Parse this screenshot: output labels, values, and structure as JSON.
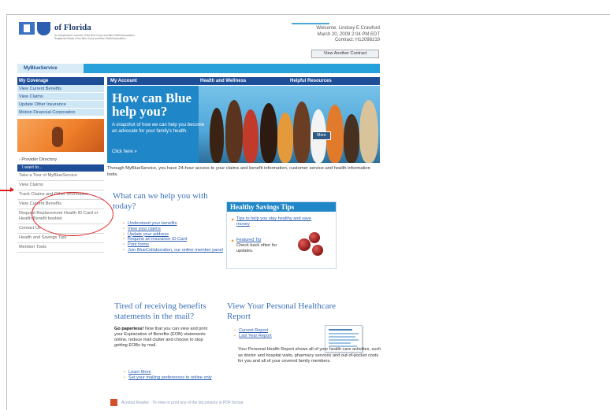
{
  "header": {
    "brand": "of Florida",
    "brand_sub": "An Independent Licensee of the Blue Cross and Blue Shield Association. Registered Marks of the Blue Cross and Blue Shield Association",
    "welcome_line": "Welcome, Lindsey E Crawford",
    "datetime": "March 20, 2009 2:04 PM EDT",
    "contract": "Contract: H12098219",
    "view_contract_button": "View Another Contract"
  },
  "brand_tab": "MyBlueService",
  "nav": {
    "my_coverage": "My Coverage",
    "my_account": "My Account",
    "health_wellness": "Health and Wellness",
    "helpful_resources": "Helpful Resources"
  },
  "coverage_items": [
    "View Current Benefits",
    "View Claims",
    "Update Other Insurance",
    "Motion Financial Corporation"
  ],
  "provider_link": "Provider Directory",
  "left_panel": {
    "head": "I want to...",
    "items": [
      "Take a Tour of MyBlueService",
      "View Claims",
      "Track Claims and Other Information",
      "View Current Benefits",
      "Request Replacement Health ID Card or Health Benefit booklet",
      "Contact Us",
      "Health and Savings Tips",
      "Member Tools"
    ]
  },
  "hero": {
    "title": "How can Blue help you?",
    "text": "A snapshot of how we can help you become an advocate for your family's health.",
    "cta": "Click here »",
    "badge": "More"
  },
  "intro": "Through MyBlueService, you have 24-hour access to your claims and benefit information, customer service and health information tools.",
  "what_section": {
    "heading": "What can we help you with today?",
    "links": [
      "Understand your benefits",
      "View your claims",
      "Update your address",
      "Request an insurance ID Card",
      "Print forms",
      "Join BlueCollaboration, our online member panel"
    ]
  },
  "healthy_tips": {
    "heading": "Healthy Savings Tips",
    "tip_link": "Tips to help you stay healthy and save money",
    "featured_label": "Featured Tip",
    "featured_text": "Check back often for updates."
  },
  "tired_section": {
    "heading": "Tired of receiving benefits statements in the mail?",
    "lead": "Go paperless!",
    "text": " Now that you can view and print your Explanation of Benefits (EOB) statements online, reduce mail clutter and choose to stop getting EOBs by mail.",
    "links": [
      "Learn More",
      "Set your mailing preferences to online only"
    ]
  },
  "report_section": {
    "heading": "View Your Personal Healthcare Report",
    "links": [
      "Current Report",
      "Last Year Report"
    ],
    "text": "Your Personal Health Report shows all of your health care activities, such as doctor and hospital visits, pharmacy services and out-of-pocket costs for you and all of your covered family members."
  },
  "footer": {
    "text": "Acrobat Reader - To view or print any of the documents in PDF format"
  },
  "colors": {
    "navy": "#1f4e99",
    "sky": "#28a0d9",
    "hero_blue": "#1f86c8",
    "annotation": "#e02020",
    "bullet_orange": "#f29a1e"
  }
}
